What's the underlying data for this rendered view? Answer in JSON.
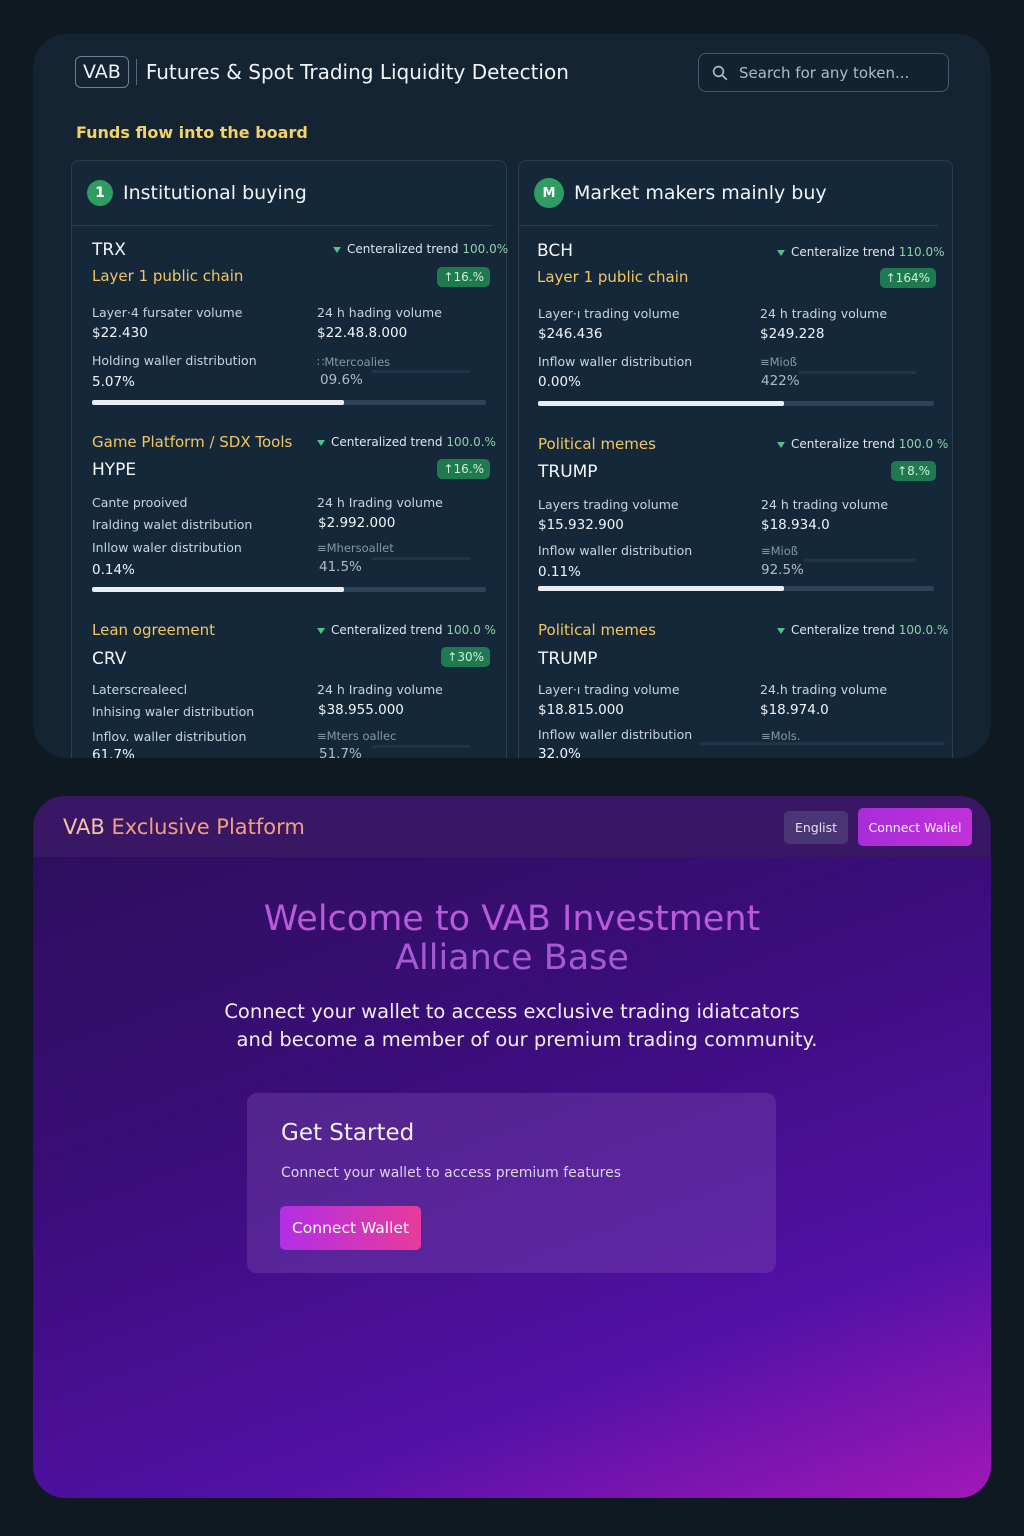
{
  "header": {
    "logo": "VAB",
    "title": "Futures & Spot Trading Liquidity Detection",
    "search_placeholder": "Search for any token..."
  },
  "section_title": "Funds flow into the board",
  "colors": {
    "accent_gold": "#f2c660",
    "trend_green": "#4fc384",
    "pill_green": "#1f7a52",
    "purple": "#3a1765"
  },
  "left_column": {
    "badge": "1",
    "title": "Institutional buying",
    "entries": [
      {
        "name": "TRX",
        "category": "Layer 1 public chain",
        "trend_label": "Centeralized trend",
        "trend_pct": "100.0%",
        "change": "↑16.%",
        "l1_label": "Layer·4 fursater volume",
        "l1_value": "$22.430",
        "r1_label": "24 h hading volume",
        "r1_value": "$22.48.8.000",
        "l2_label": "Holding waller distribution",
        "l2_value": "5.07%",
        "r2_label": "∷Mtercoalies",
        "r2_value": "09.6%",
        "progress": 0.64
      },
      {
        "name": "HYPE",
        "category": "Game Platform / SDX Tools",
        "trend_label": "Centeralized trend",
        "trend_pct": "100.0.%",
        "change": "↑16.%",
        "l1_label": "Cante prooived",
        "r1_label": "24 h Irading volume",
        "r1_value": "$2.992.000",
        "l2_label": "Iralding walet distribution",
        "l3_label": "Inllow waler distribution",
        "l3_value": "0.14%",
        "r3_label": "≡Mhersoallet",
        "r3_value": "41.5%",
        "progress": 0.64
      },
      {
        "name": "CRV",
        "category": "Lean ogreement",
        "trend_label": "Centeralized trend",
        "trend_pct": "100.0 %",
        "change": "↑30%",
        "l1_label": "Laterscrealeecl",
        "r1_label": "24 h Irading volume",
        "r1_value": "$38.955.000",
        "l2_label": "Inhising waler distribution",
        "l3_label": "Inflov. waller distribution",
        "l3_value": "61.7%",
        "r3_label": "≡Mters oallec",
        "r3_value": "51.7%"
      }
    ]
  },
  "right_column": {
    "badge": "M",
    "title": "Market makers mainly buy",
    "entries": [
      {
        "name": "BCH",
        "category": "Layer 1 public chain",
        "trend_label": "Centeralize trend",
        "trend_pct": "110.0%",
        "change": "↑164%",
        "l1_label": "Layer·ı trading volume",
        "l1_value": "$246.436",
        "r1_label": "24 h trading volume",
        "r1_value": "$249.228",
        "l2_label": "Inflow waller distribution",
        "l2_value": "0.00%",
        "r2_label": "≡Mioß",
        "r2_value": "422%",
        "progress": 0.62
      },
      {
        "name": "TRUMP",
        "category": "Political memes",
        "trend_label": "Centeralize trend",
        "trend_pct": "100.0 %",
        "change": "↑8.%",
        "l1_label": "Layers trading volume",
        "l1_value": "$15.932.900",
        "r1_label": "24 h trading volume",
        "r1_value": "$18.934.0",
        "l2_label": "Inflow waller distribution",
        "l2_value": "0.11%",
        "r2_label": "≡Mioß",
        "r2_value": "92.5%",
        "progress": 0.62
      },
      {
        "name": "TRUMP",
        "category": "Political memes",
        "trend_label": "Centeralize trend",
        "trend_pct": "100.0.%",
        "l1_label": "Layer·ı trading volume",
        "l1_value": "$18.815.000",
        "r1_label": "24.h trading volume",
        "r1_value": "$18.974.0",
        "l2_label": "Inflow waller distribution",
        "l2_value": "32.0%",
        "r2_label": "≡Mols."
      }
    ]
  },
  "platform": {
    "brand_prefix": "VAB",
    "brand_rest": " Exclusive Platform",
    "lang_button": "Englist",
    "connect_top": "Connect Waliel",
    "hero_line1": "Welcome to VAB Investment",
    "hero_line2": "Alliance Base",
    "sub_line1": "Connect your wallet to access exclusive trading idiatcators",
    "sub_line2": "and become a member of our premium trading community.",
    "card_title": "Get Started",
    "card_sub": "Connect your wallet to access premium features",
    "card_button": "Connect Wallet"
  }
}
